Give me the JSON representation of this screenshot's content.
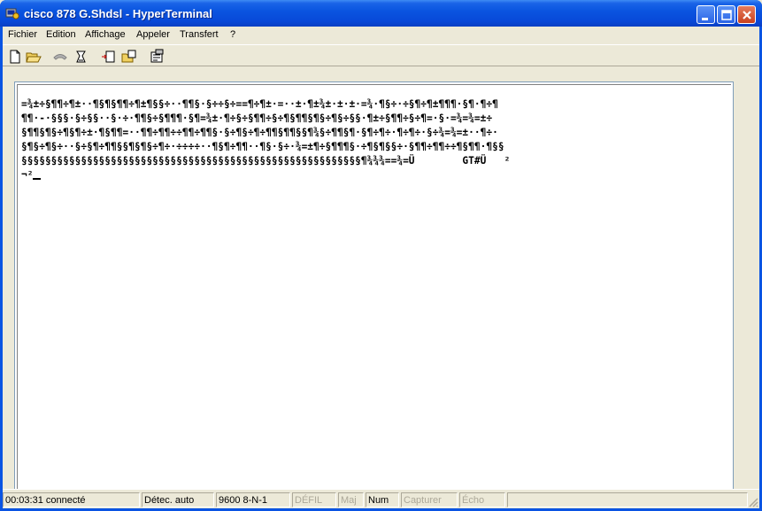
{
  "window": {
    "title": "cisco 878 G.Shdsl - HyperTerminal",
    "icon": "hyperterminal-app-icon",
    "controls": [
      "minimize-icon",
      "maximize-icon",
      "close-icon"
    ]
  },
  "menu": {
    "items": [
      {
        "label": "Fichier"
      },
      {
        "label": "Edition"
      },
      {
        "label": "Affichage"
      },
      {
        "label": "Appeler"
      },
      {
        "label": "Transfert"
      },
      {
        "label": "?"
      }
    ]
  },
  "toolbar": {
    "tools": [
      "new-document-icon",
      "open-folder-icon",
      "disconnect-phone-icon",
      "dial-phone-icon",
      "send-file-icon",
      "receive-file-icon",
      "properties-icon"
    ]
  },
  "terminal": {
    "lines": [
      "=¾±÷§¶¶÷¶±··¶§¶§¶¶÷¶±¶§§÷··¶¶§·§÷÷§÷==¶÷¶±·=··±·¶±¾±·±·±·=¾·¶§÷·÷§¶÷¶±¶¶¶·§¶·¶÷¶",
      "¶¶·-·§§§·§÷§§··§·÷·¶¶§÷§¶¶¶·§¶=¾±·¶÷§÷§¶¶÷§÷¶§¶¶§¶§÷¶§÷§§·¶±÷§¶¶÷§÷¶=·§·=¾=¾=±÷",
      "§¶¶§¶§÷¶§¶÷±·¶§¶¶=··¶¶÷¶¶÷÷¶¶÷¶¶§·§÷¶§÷¶÷¶¶§¶¶§§¶¾§÷¶¶§¶·§¶÷¶÷·¶÷¶÷·§÷¾=¾=±··¶÷·",
      "§¶§÷¶§÷··§÷§¶÷¶¶§§¶§¶§÷¶÷·÷÷÷÷··¶§¶÷¶¶··¶§·§÷·¾=±¶÷§¶¶¶§·÷¶§¶§§÷·§¶¶÷¶¶÷÷¶§¶¶·¶§§",
      "§§§§§§§§§§§§§§§§§§§§§§§§§§§§§§§§§§§§§§§§§§§§§§§§§§§§§§§§§¶¾¾¾==¾=Ü        GT#Ü   ²"
    ],
    "line_tail": "¬²"
  },
  "status": {
    "time": "00:03:31 connecté",
    "detect": "Détec. auto",
    "port": "9600 8-N-1",
    "scroll": "DÉFIL",
    "caps": "Maj",
    "num": "Num",
    "capture": "Capturer",
    "echo": "Écho"
  }
}
